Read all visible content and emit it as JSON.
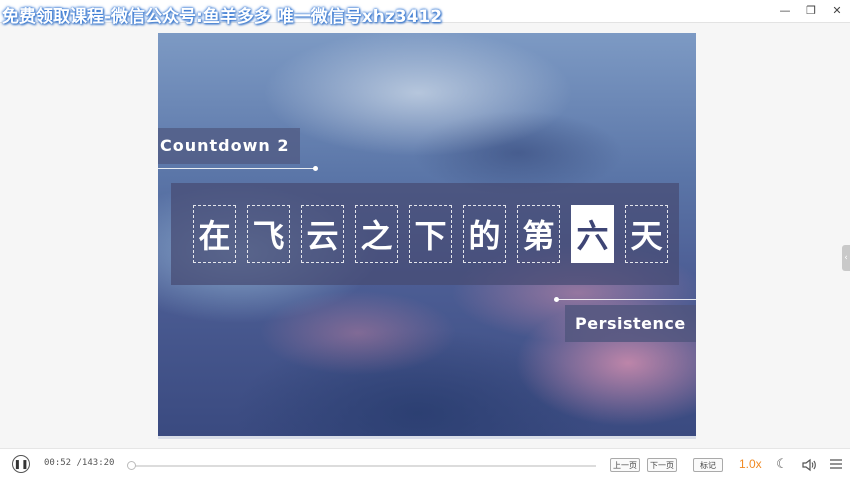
{
  "window": {
    "watermark": "免费领取课程-微信公众号:鱼羊多多 唯一微信号xhz3412",
    "controls": {
      "minimize": "—",
      "restore": "❐",
      "close": "✕"
    }
  },
  "slide": {
    "tag_top": "Countdown 2",
    "characters": [
      "在",
      "飞",
      "云",
      "之",
      "下",
      "的",
      "第",
      "六",
      "天"
    ],
    "highlight_index": 7,
    "tag_bottom": "Persistence"
  },
  "player": {
    "current_time": "00:52",
    "total_time": "/143:20",
    "progress_fraction": 0.006,
    "prev_page_label": "上一页",
    "next_page_label": "下一页",
    "bookmark_label": "标记",
    "speed": "1.0x",
    "icons": {
      "play": "pause-icon",
      "night": "moon-icon",
      "volume": "volume-icon",
      "menu": "menu-icon"
    }
  },
  "colors": {
    "accent": "#f08a24",
    "banner": "#464b73"
  }
}
